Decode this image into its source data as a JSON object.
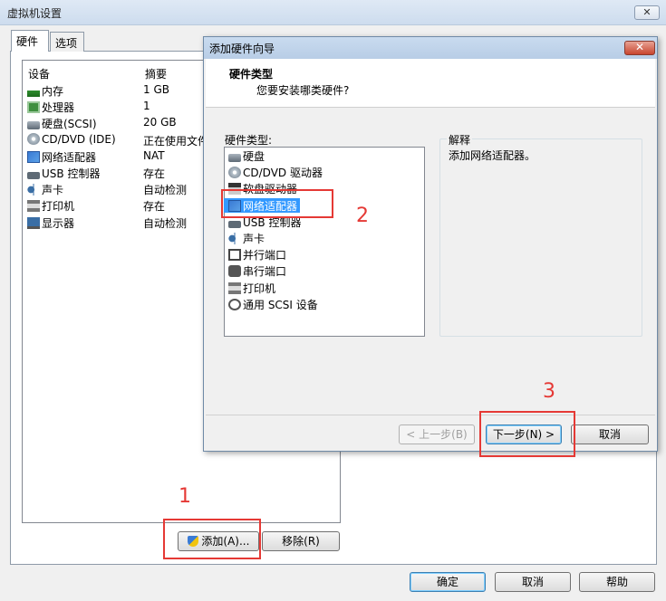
{
  "main_window": {
    "title": "虚拟机设置",
    "close_glyph": "✕",
    "tabs": [
      {
        "label": "硬件"
      },
      {
        "label": "选项"
      }
    ],
    "columns": {
      "device": "设备",
      "summary": "摘要"
    },
    "devices": [
      {
        "name": "内存",
        "summary": "1 GB",
        "icon": "memory-icon"
      },
      {
        "name": "处理器",
        "summary": "1",
        "icon": "cpu-icon"
      },
      {
        "name": "硬盘(SCSI)",
        "summary": "20 GB",
        "icon": "harddisk-icon"
      },
      {
        "name": "CD/DVD (IDE)",
        "summary": "正在使用文件",
        "icon": "cdrom-icon"
      },
      {
        "name": "网络适配器",
        "summary": "NAT",
        "icon": "network-icon"
      },
      {
        "name": "USB 控制器",
        "summary": "存在",
        "icon": "usb-icon"
      },
      {
        "name": "声卡",
        "summary": "自动检测",
        "icon": "sound-icon"
      },
      {
        "name": "打印机",
        "summary": "存在",
        "icon": "printer-icon"
      },
      {
        "name": "显示器",
        "summary": "自动检测",
        "icon": "display-icon"
      }
    ],
    "add_button": "添加(A)...",
    "remove_button": "移除(R)",
    "ok_button": "确定",
    "cancel_button": "取消",
    "help_button": "帮助"
  },
  "dialog": {
    "title": "添加硬件向导",
    "close_glyph": "✕",
    "heading": "硬件类型",
    "subheading": "您要安装哪类硬件?",
    "list_label": "硬件类型:",
    "hardware_types": [
      {
        "label": "硬盘",
        "icon": "harddisk-icon"
      },
      {
        "label": "CD/DVD 驱动器",
        "icon": "cdrom-icon"
      },
      {
        "label": "软盘驱动器",
        "icon": "floppy-icon"
      },
      {
        "label": "网络适配器",
        "icon": "network-icon",
        "selected": true
      },
      {
        "label": "USB 控制器",
        "icon": "usb-icon"
      },
      {
        "label": "声卡",
        "icon": "sound-icon"
      },
      {
        "label": "并行端口",
        "icon": "parallel-port-icon"
      },
      {
        "label": "串行端口",
        "icon": "serial-port-icon"
      },
      {
        "label": "打印机",
        "icon": "printer-icon"
      },
      {
        "label": "通用 SCSI 设备",
        "icon": "scsi-icon"
      }
    ],
    "explain_title": "解释",
    "explain_text": "添加网络适配器。",
    "back_button": "< 上一步(B)",
    "next_button": "下一步(N) >",
    "cancel_button": "取消"
  },
  "annotations": {
    "step1": "1",
    "step2": "2",
    "step3": "3"
  },
  "colors": {
    "annotation_red": "#e53935",
    "selection_blue": "#3399ff"
  }
}
